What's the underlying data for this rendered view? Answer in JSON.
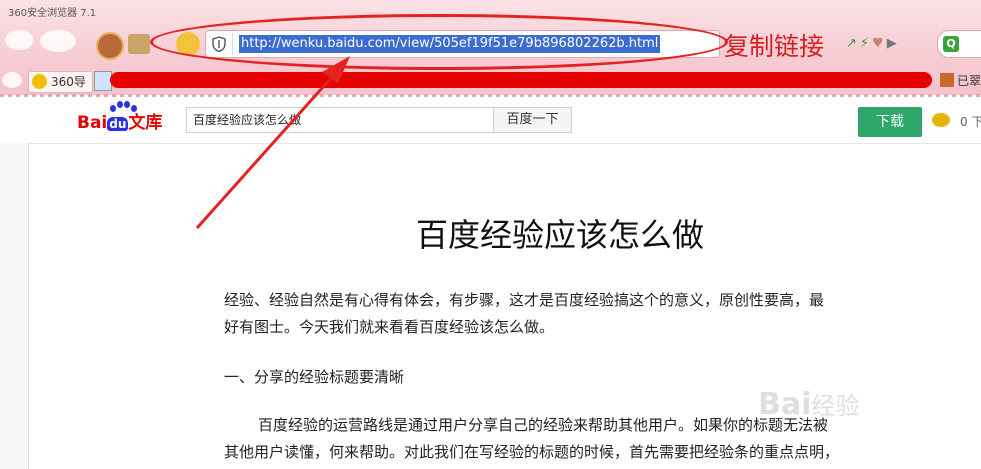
{
  "browser": {
    "title": "360安全浏览器 7.1",
    "url": "http://wenku.baidu.com/view/505ef19f51e79b896802262b.html",
    "favorites": {
      "item1": "360导",
      "item_right": "已翠"
    }
  },
  "annotation": {
    "label": "复制链接",
    "color": "#e42321"
  },
  "baidu": {
    "logo_text_red": "Bai",
    "logo_text_blue": "du",
    "logo_text_wenku": "文库",
    "search_value": "百度经验应该怎么做",
    "search_button": "百度一下",
    "download_button": "下载",
    "coins": "0 下"
  },
  "document": {
    "title": "百度经验应该怎么做",
    "para1_line1": "经验、经验自然是有心得有体会，有步骤，这才是百度经验搞这个的意义，原创性要高，最",
    "para1_line2": "好有图士。今天我们就来看看百度经验该怎么做。",
    "heading1": "一、分享的经验标题要清晰",
    "para2_line1": "百度经验的运营路线是通过用户分享自己的经验来帮助其他用户。如果你的标题无法被",
    "para2_line2": "其他用户读懂，何来帮助。对此我们在写经验的标题的时候，首先需要把经验条的重点点明，"
  },
  "watermark": {
    "main": "Bai",
    "sub": "经验"
  },
  "colors": {
    "download": "#2fa66a",
    "url_highlight": "#3c6ccf",
    "annotation": "#e42321"
  }
}
